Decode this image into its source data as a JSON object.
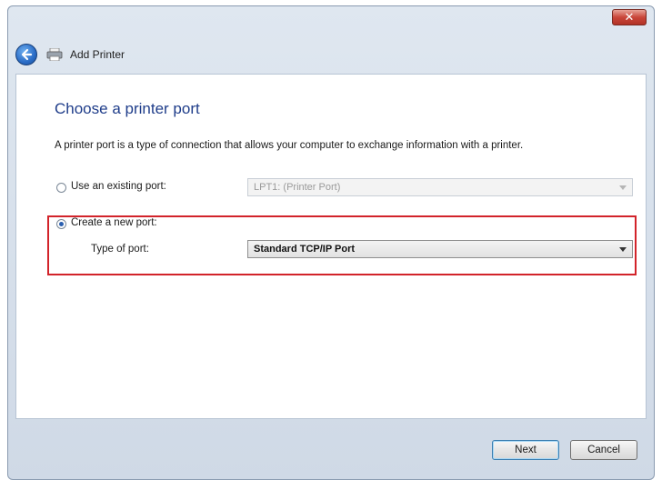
{
  "window": {
    "close_glyph": "✕",
    "nav_title": "Add Printer"
  },
  "page": {
    "heading": "Choose a printer port",
    "description": "A printer port is a type of connection that allows your computer to exchange information with a printer."
  },
  "options": {
    "existing": {
      "label": "Use an existing port:",
      "selected": false,
      "value": "LPT1: (Printer Port)"
    },
    "create_new": {
      "label": "Create a new port:",
      "selected": true,
      "type_label": "Type of port:",
      "value": "Standard TCP/IP Port"
    }
  },
  "buttons": {
    "next": "Next",
    "cancel": "Cancel"
  },
  "icons": [
    "back-arrow-icon",
    "printer-icon",
    "close-icon",
    "chevron-down-icon"
  ],
  "colors": {
    "heading": "#1f3d8a",
    "highlight": "#d2232a",
    "close_button": "#c9463a"
  }
}
